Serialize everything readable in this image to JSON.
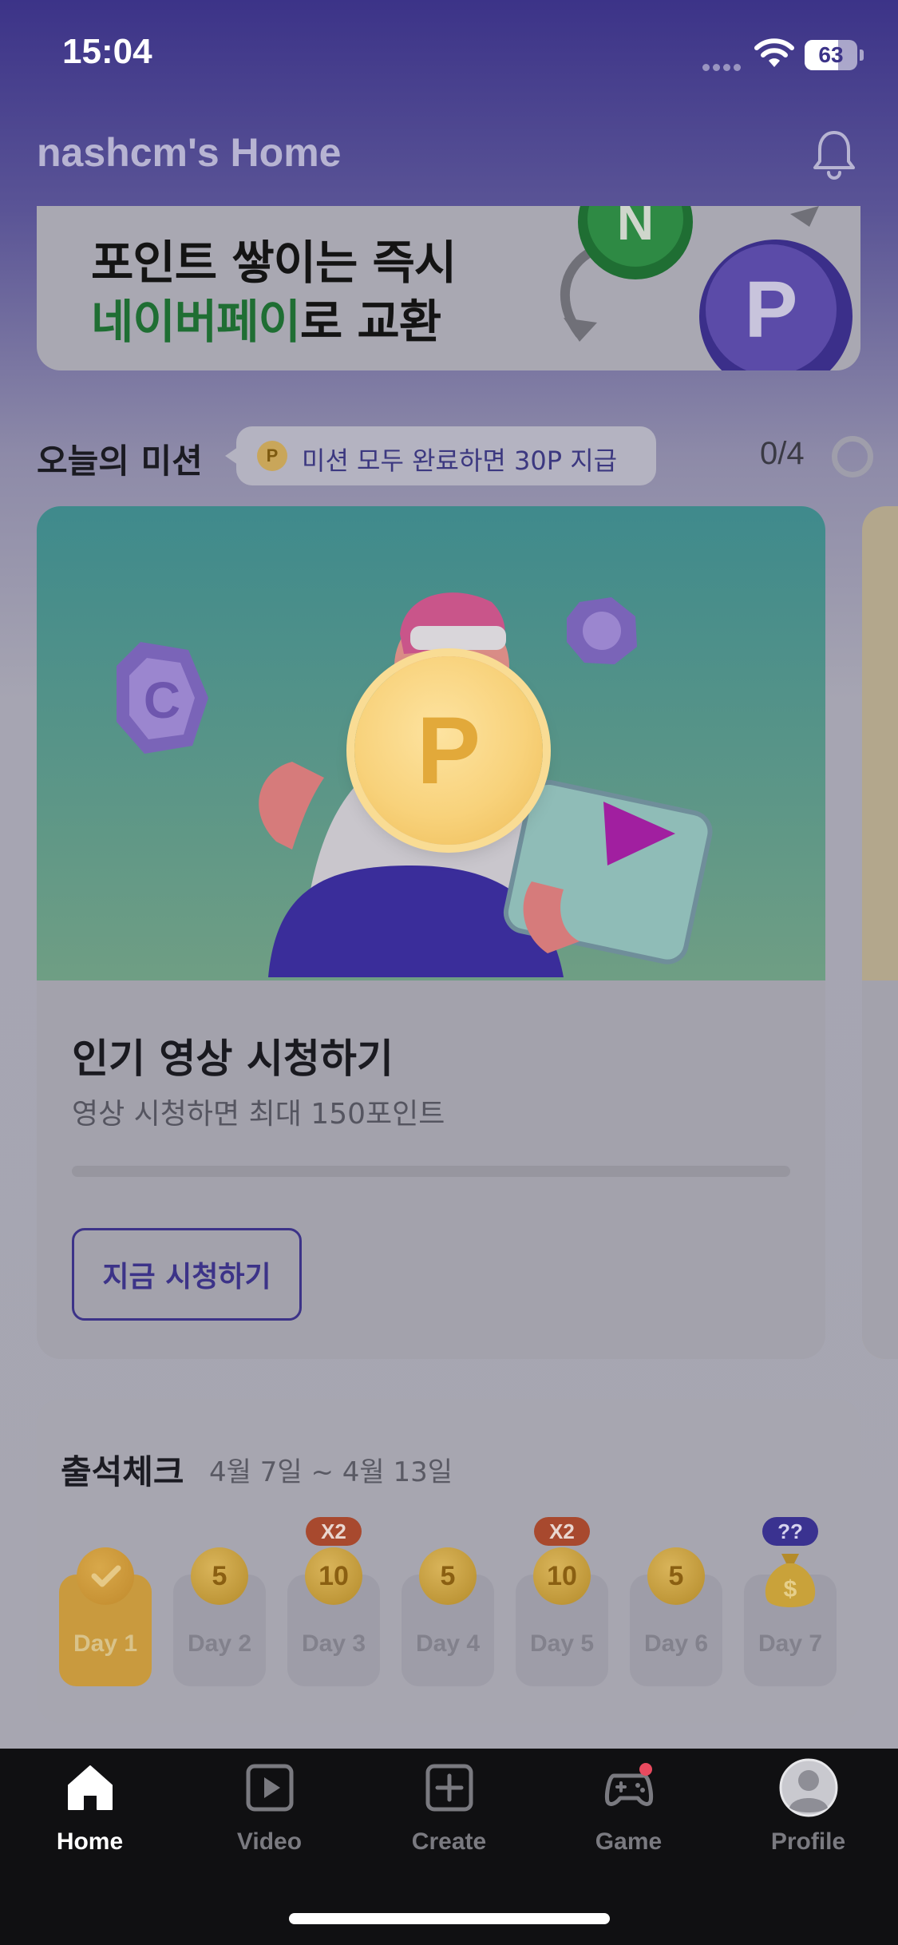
{
  "status_bar": {
    "time": "15:04",
    "battery": "63",
    "battery_level": 0.63
  },
  "header": {
    "title": "nashcm's Home",
    "icon": "bell-icon"
  },
  "banner": {
    "line1": "포인트 쌓이는 즉시",
    "line2_highlight": "네이버페이",
    "line2_rest": "로 교환"
  },
  "mission": {
    "section_title": "오늘의 미션",
    "pill_coin": "P",
    "pill_text": "미션 모두 완료하면 30P 지급",
    "progress": "0/4",
    "card": {
      "title": "인기 영상 시청하기",
      "description": "영상 시청하면 최대 150포인트",
      "progress_fraction": 0,
      "button_label": "지금 시청하기"
    },
    "center_coin": "P"
  },
  "attendance": {
    "title": "출석체크",
    "range": "4월 7일 ~ 4월 13일",
    "days": [
      {
        "label": "Day 1",
        "reward": "",
        "badge": "",
        "state": "checked"
      },
      {
        "label": "Day 2",
        "reward": "5",
        "badge": "",
        "state": "pending"
      },
      {
        "label": "Day 3",
        "reward": "10",
        "badge": "X2",
        "state": "pending"
      },
      {
        "label": "Day 4",
        "reward": "5",
        "badge": "",
        "state": "pending"
      },
      {
        "label": "Day 5",
        "reward": "10",
        "badge": "X2",
        "state": "pending"
      },
      {
        "label": "Day 6",
        "reward": "5",
        "badge": "",
        "state": "pending"
      },
      {
        "label": "Day 7",
        "reward": "$",
        "badge": "??",
        "state": "mystery"
      }
    ]
  },
  "tab_bar": {
    "tabs": [
      {
        "label": "Home",
        "icon": "home-icon",
        "active": true
      },
      {
        "label": "Video",
        "icon": "video-icon",
        "active": false
      },
      {
        "label": "Create",
        "icon": "create-icon",
        "active": false
      },
      {
        "label": "Game",
        "icon": "game-icon",
        "active": false
      },
      {
        "label": "Profile",
        "icon": "profile-icon",
        "active": false
      }
    ]
  },
  "colors": {
    "accent": "#3c3388",
    "coin": "#f8d27b",
    "bonus": "#a8492e"
  }
}
